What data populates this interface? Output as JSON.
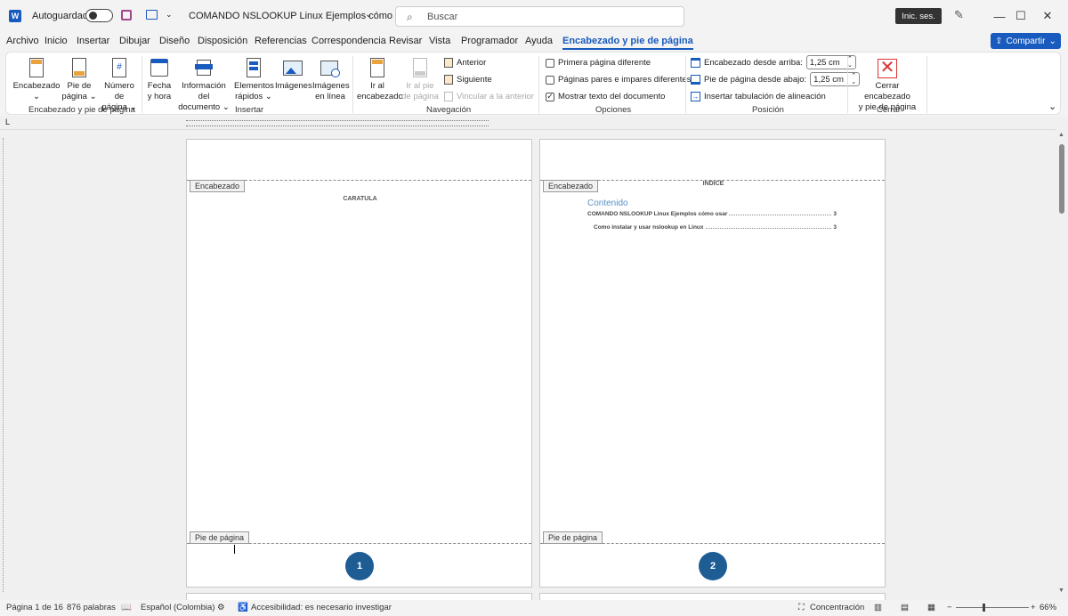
{
  "titlebar": {
    "autosave_label": "Autoguardado",
    "doc_title": "COMANDO NSLOOKUP Linux  Ejemplos cómo usar",
    "search_placeholder": "Buscar",
    "signin_label": "Inic. ses."
  },
  "menu": {
    "items": [
      "Archivo",
      "Inicio",
      "Insertar",
      "Dibujar",
      "Diseño",
      "Disposición",
      "Referencias",
      "Correspondencia",
      "Revisar",
      "Vista",
      "Programador",
      "Ayuda",
      "Encabezado y pie de página"
    ],
    "share_label": "Compartir"
  },
  "ribbon": {
    "encabezado": "Encabezado",
    "pie_1": "Pie de",
    "pie_2": "página",
    "numero_1": "Número de",
    "numero_2": "página",
    "group1": "Encabezado y pie de página",
    "fecha_1": "Fecha",
    "fecha_2": "y hora",
    "info_1": "Información del",
    "info_2": "documento",
    "elem_1": "Elementos",
    "elem_2": "rápidos",
    "imagenes": "Imágenes",
    "imglinea_1": "Imágenes",
    "imglinea_2": "en línea",
    "group2": "Insertar",
    "iralenc_1": "Ir al",
    "iralenc_2": "encabezado",
    "iralpie_1": "Ir al pie",
    "iralpie_2": "de página",
    "anterior": "Anterior",
    "siguiente": "Siguiente",
    "vincular": "Vincular a la anterior",
    "group3": "Navegación",
    "primera": "Primera página diferente",
    "pares": "Páginas pares e impares diferentes",
    "mostrar": "Mostrar texto del documento",
    "group4": "Opciones",
    "enc_desde": "Encabezado desde arriba:",
    "enc_val": "1,25 cm",
    "pie_desde": "Pie de página desde abajo:",
    "pie_val": "1,25 cm",
    "tabulacion": "Insertar tabulación de alineación",
    "group5": "Posición",
    "cerrar_1": "Cerrar encabezado",
    "cerrar_2": "y pie de página",
    "group6": "Cerrar"
  },
  "document": {
    "page1": {
      "header_tag": "Encabezado",
      "title": "CARATULA",
      "footer_tag": "Pie de página",
      "page_number": "1"
    },
    "page2": {
      "header_tag": "Encabezado",
      "title": "INDICE",
      "toc_heading": "Contenido",
      "toc": [
        {
          "text": "COMANDO NSLOOKUP Linux  Ejemplos cómo usar",
          "page": "3"
        },
        {
          "text": "Como instalar y usar nslookup en Linux",
          "page": "3"
        }
      ],
      "footer_tag": "Pie de página",
      "page_number": "2"
    }
  },
  "status": {
    "page": "Página 1 de 16",
    "words": "876 palabras",
    "language": "Español (Colombia)",
    "accessibility": "Accesibilidad: es necesario investigar",
    "focus": "Concentración",
    "zoom": "66%"
  },
  "colors": {
    "accent": "#185abd",
    "pagenum": "#1e5c94"
  }
}
